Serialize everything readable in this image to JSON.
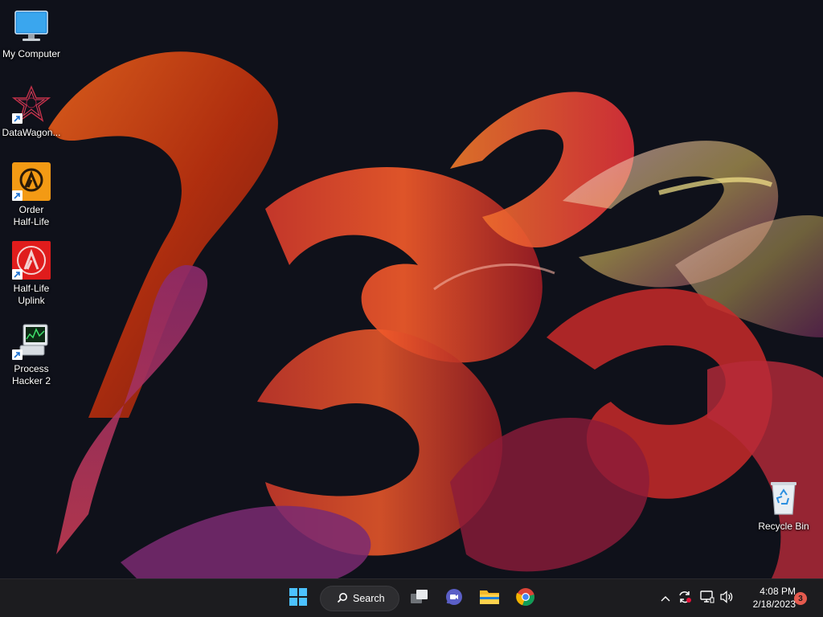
{
  "desktop": {
    "icons": [
      {
        "label": "My Computer"
      },
      {
        "label": "DataWagon..."
      },
      {
        "label": "Order\nHalf-Life"
      },
      {
        "label": "Half-Life\nUplink"
      },
      {
        "label": "Process\nHacker 2"
      },
      {
        "label": "Recycle Bin"
      }
    ]
  },
  "taskbar": {
    "search_label": "Search",
    "pinned": [
      {
        "icon": "windows-start-icon"
      },
      {
        "icon": "task-view-icon"
      },
      {
        "icon": "teams-chat-icon"
      },
      {
        "icon": "file-explorer-icon"
      },
      {
        "icon": "chrome-icon"
      }
    ],
    "tray": {
      "icons": [
        "chevron-up-icon",
        "sync-icon",
        "network-icon",
        "volume-icon"
      ],
      "time": "4:08 PM",
      "date": "2/18/2023",
      "notification_count": "3"
    }
  },
  "colors": {
    "taskbar_bg": "#1c1c1f",
    "wallpaper_bg": "#0f111a",
    "accent": "#0078d4",
    "notification_badge": "#e55a4e"
  }
}
